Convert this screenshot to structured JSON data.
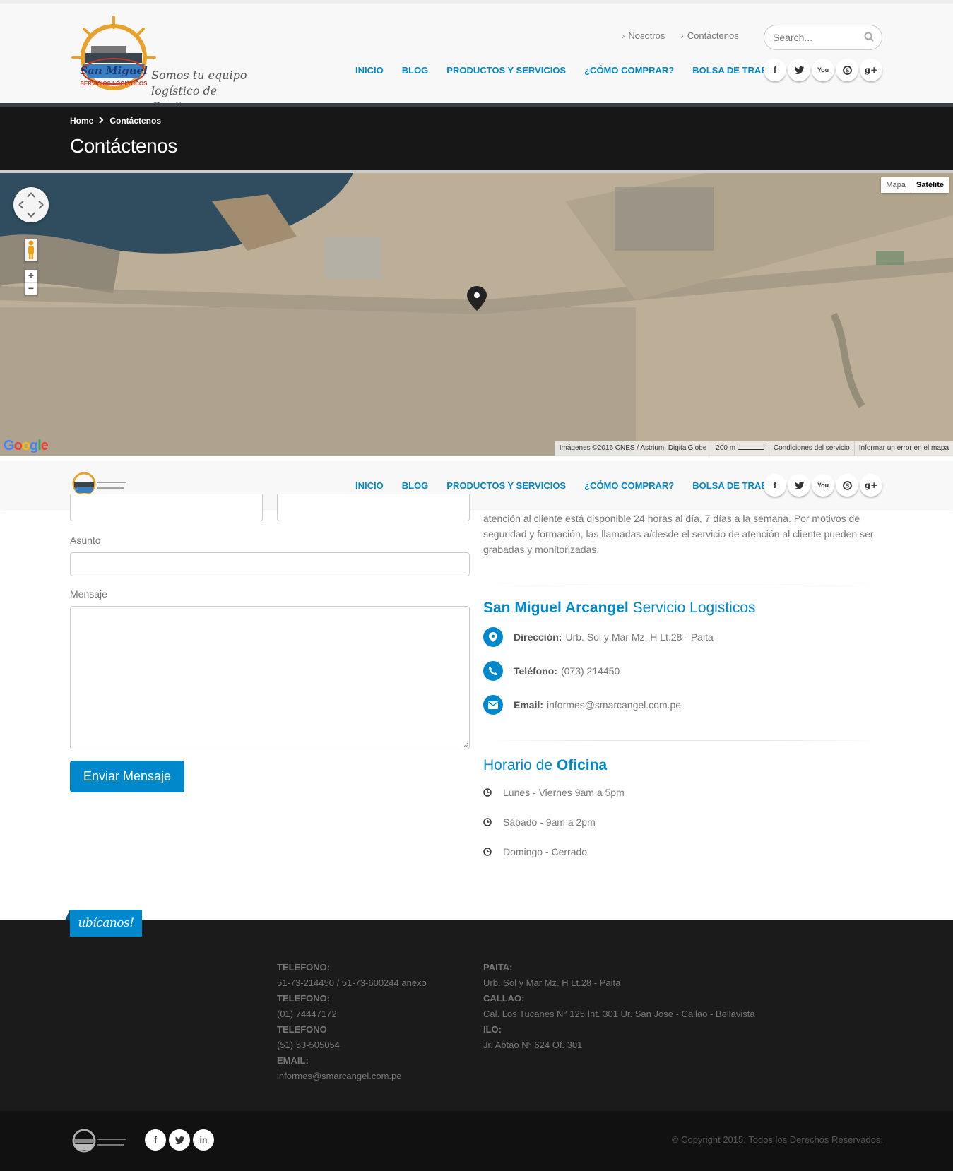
{
  "brand": {
    "logo_name": "San Miguel",
    "logo_sub": "SERVICIOS LOGISTICOS",
    "tagline": "Somos tu equipo logístico de Confianza"
  },
  "top_links": [
    {
      "label": "Nosotros"
    },
    {
      "label": "Contáctenos"
    }
  ],
  "search": {
    "placeholder": "Search..."
  },
  "nav": [
    {
      "label": "INICIO"
    },
    {
      "label": "BLOG"
    },
    {
      "label": "PRODUCTOS Y SERVICIOS"
    },
    {
      "label": "¿CÓMO COMPRAR?"
    },
    {
      "label": "BOLSA DE TRABAJO"
    }
  ],
  "social_icons": [
    "facebook-icon",
    "twitter-icon",
    "youtube-icon",
    "skype-icon",
    "google-plus-icon"
  ],
  "breadcrumb": {
    "home": "Home",
    "current": "Contáctenos"
  },
  "page_title": "Contáctenos",
  "map": {
    "type_map": "Mapa",
    "type_satellite": "Satélite",
    "brand": "Google",
    "attribution": "Imágenes ©2016 CNES / Astrium, DigitalGlobe",
    "scale": "200 m",
    "terms": "Condiciones del servicio",
    "report": "Informar un error en el mapa"
  },
  "form": {
    "subject_label": "Asunto",
    "message_label": "Mensaje",
    "submit_label": "Enviar Mensaje"
  },
  "contact": {
    "intro": "atención al cliente está disponible 24 horas al día, 7 días a la semana. Por motivos de seguridad y formación, las llamadas a/desde el servicio de atención al cliente pueden ser grabadas y monitorizadas.",
    "heading_bold": "San Miguel Arcangel",
    "heading_rest": "Servicio Logisticos",
    "address_label": "Dirección:",
    "address": "Urb. Sol y Mar Mz. H Lt.28 - Paita",
    "phone_label": "Teléfono:",
    "phone": "(073) 214450",
    "email_label": "Email:",
    "email": "informes@smarcangel.com.pe"
  },
  "hours": {
    "heading_a": "Horario de",
    "heading_b": "Oficina",
    "rows": [
      "Lunes - Viernes 9am a 5pm",
      "Sábado - 9am a 2pm",
      "Domingo - Cerrado"
    ]
  },
  "footer": {
    "ribbon": "ubícanos!",
    "col1": [
      {
        "label": "TELEFONO:",
        "value": "51-73-214450 / 51-73-600244 anexo"
      },
      {
        "label": "TELEFONO:",
        "value": "(01) 74447172"
      },
      {
        "label": "TELEFONO",
        "value": "(51) 53-505054"
      },
      {
        "label": "EMAIL:",
        "value": "informes@smarcangel.com.pe"
      }
    ],
    "col2": [
      {
        "label": "PAITA:",
        "value": "Urb. Sol y Mar Mz. H Lt.28 - Paita"
      },
      {
        "label": "CALLAO:",
        "value": "Cal. Los Tucanes N° 125 Int. 301 Ur. San Jose - Callao - Bellavista"
      },
      {
        "label": "ILO:",
        "value": "Jr. Abtao N° 624 Of. 301"
      }
    ],
    "copyright": "© Copyright 2015. Todos los Derechos Reservados.",
    "social_icons": [
      "facebook-icon",
      "twitter-icon",
      "linkedin-icon"
    ]
  },
  "colors": {
    "accent": "#0088cc",
    "footer_bg": "#1b1b1b",
    "pagebar_bg": "#171717"
  }
}
